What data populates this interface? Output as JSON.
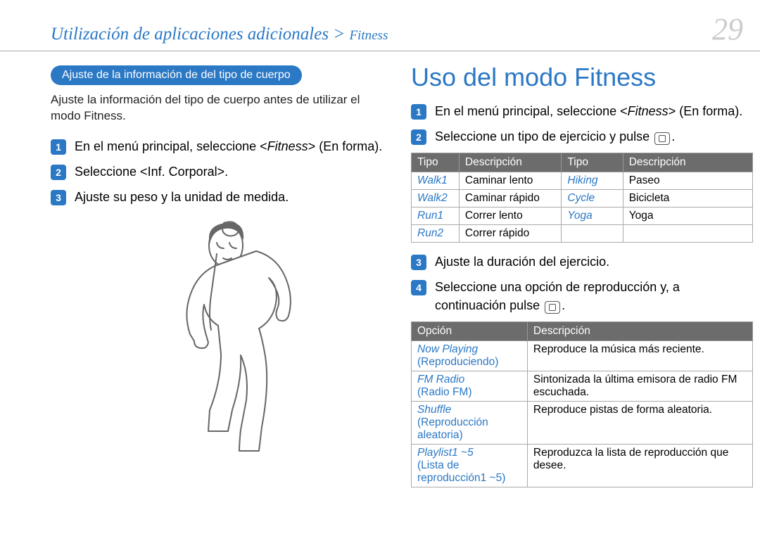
{
  "page_number": "29",
  "breadcrumb": {
    "main": "Utilización de aplicaciones adicionales",
    "sep": " > ",
    "sub": "Fitness"
  },
  "left": {
    "section_label": "Ajuste de la información de del tipo de cuerpo",
    "intro": "Ajuste la información del tipo de cuerpo antes de utilizar el modo Fitness.",
    "steps": {
      "s1_pre": "En el menú principal, seleccione <",
      "s1_it": "Fitness",
      "s1_post": "> (En forma).",
      "s2": "Seleccione <Inf. Corporal>.",
      "s3": "Ajuste su peso y la unidad de medida."
    }
  },
  "right": {
    "heading": "Uso del modo Fitness",
    "steps": {
      "s1_pre": "En el menú principal, seleccione <",
      "s1_it": "Fitness",
      "s1_post": "> (En forma).",
      "s2_pre": "Seleccione un tipo de ejercicio y pulse ",
      "s2_post": ".",
      "s3": "Ajuste la duración del ejercicio.",
      "s4_pre": "Seleccione una opción de reproducción y, a continuación pulse ",
      "s4_post": "."
    },
    "table1": {
      "headers": {
        "h1": "Tipo",
        "h2": "Descripción",
        "h3": "Tipo",
        "h4": "Descripción"
      },
      "rows": [
        {
          "t1": "Walk1",
          "d1": "Caminar lento",
          "t2": "Hiking",
          "d2": "Paseo"
        },
        {
          "t1": "Walk2",
          "d1": "Caminar rápido",
          "t2": "Cycle",
          "d2": "Bicicleta"
        },
        {
          "t1": "Run1",
          "d1": "Correr lento",
          "t2": "Yoga",
          "d2": "Yoga"
        },
        {
          "t1": "Run2",
          "d1": "Correr rápido",
          "t2": "",
          "d2": ""
        }
      ]
    },
    "table2": {
      "headers": {
        "h1": "Opción",
        "h2": "Descripción"
      },
      "rows": [
        {
          "en": "Now Playing",
          "es": "(Reproduciendo)",
          "desc": "Reproduce la música más reciente."
        },
        {
          "en": "FM Radio",
          "es": "(Radio FM)",
          "desc": "Sintonizada la última emisora de radio FM escuchada."
        },
        {
          "en": "Shuffle",
          "es": "(Reproducción aleatoria)",
          "desc": "Reproduce pistas de forma aleatoria."
        },
        {
          "en": "Playlist1 ~5",
          "es": "(Lista de reproducción1 ~5)",
          "desc": "Reproduzca la lista de reproducción que desee."
        }
      ]
    }
  },
  "chart_data": [
    {
      "type": "table",
      "title": "Tipos de ejercicio",
      "columns": [
        "Tipo",
        "Descripción"
      ],
      "rows": [
        [
          "Walk1",
          "Caminar lento"
        ],
        [
          "Walk2",
          "Caminar rápido"
        ],
        [
          "Run1",
          "Correr lento"
        ],
        [
          "Run2",
          "Correr rápido"
        ],
        [
          "Hiking",
          "Paseo"
        ],
        [
          "Cycle",
          "Bicicleta"
        ],
        [
          "Yoga",
          "Yoga"
        ]
      ]
    },
    {
      "type": "table",
      "title": "Opciones de reproducción",
      "columns": [
        "Opción",
        "Descripción"
      ],
      "rows": [
        [
          "Now Playing (Reproduciendo)",
          "Reproduce la música más reciente."
        ],
        [
          "FM Radio (Radio FM)",
          "Sintonizada la última emisora de radio FM escuchada."
        ],
        [
          "Shuffle (Reproducción aleatoria)",
          "Reproduce pistas de forma aleatoria."
        ],
        [
          "Playlist1 ~5 (Lista de reproducción1 ~5)",
          "Reproduzca la lista de reproducción que desee."
        ]
      ]
    }
  ]
}
